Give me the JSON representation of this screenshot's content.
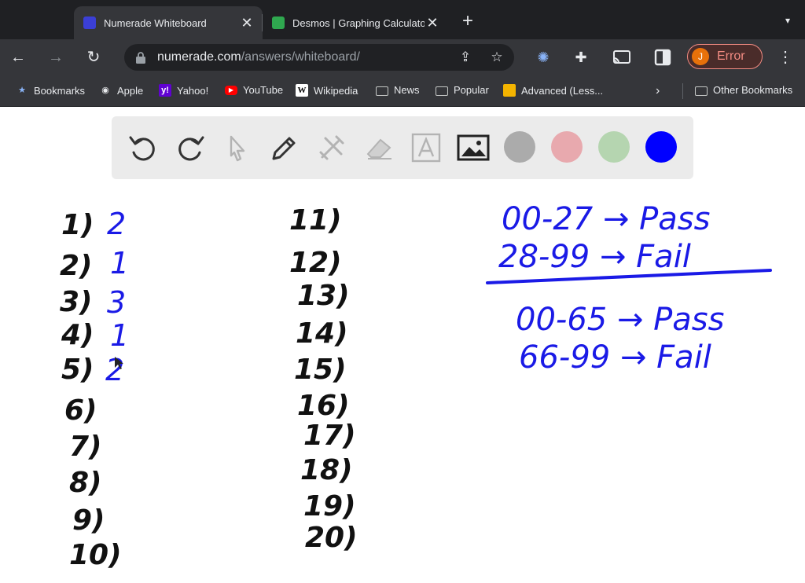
{
  "browser": {
    "tabs": [
      {
        "title": "Numerade Whiteboard",
        "active": true,
        "favicon": "numerade-icon"
      },
      {
        "title": "Desmos | Graphing Calculator",
        "active": false,
        "favicon": "desmos-icon"
      }
    ],
    "address": {
      "host": "numerade.com",
      "path": "/answers/whiteboard/"
    },
    "profile": {
      "initial": "J",
      "status": "Error"
    },
    "bookmarks": [
      {
        "label": "Bookmarks",
        "icon": "star-icon"
      },
      {
        "label": "Apple",
        "icon": "apple-icon"
      },
      {
        "label": "Yahoo!",
        "icon": "yahoo-icon"
      },
      {
        "label": "YouTube",
        "icon": "youtube-icon"
      },
      {
        "label": "Wikipedia",
        "icon": "wikipedia-icon"
      },
      {
        "label": "News",
        "icon": "folder-icon"
      },
      {
        "label": "Popular",
        "icon": "folder-icon"
      },
      {
        "label": "Advanced (Less...",
        "icon": "advanced-icon"
      }
    ],
    "other_bookmarks": "Other Bookmarks"
  },
  "whiteboard": {
    "tools": [
      "undo",
      "redo",
      "select",
      "pen",
      "tools",
      "eraser",
      "text",
      "image"
    ],
    "colors": [
      "#ababab",
      "#e8a9ae",
      "#b5d5b0",
      "#0000ff"
    ],
    "selected_color": "#0000ff"
  },
  "handwriting": {
    "left_list": [
      {
        "label": "1)",
        "answer": "2"
      },
      {
        "label": "2)",
        "answer": "1"
      },
      {
        "label": "3)",
        "answer": "3"
      },
      {
        "label": "4)",
        "answer": "1"
      },
      {
        "label": "5)",
        "answer": "2"
      },
      {
        "label": "6)",
        "answer": ""
      },
      {
        "label": "7)",
        "answer": ""
      },
      {
        "label": "8)",
        "answer": ""
      },
      {
        "label": "9)",
        "answer": ""
      },
      {
        "label": "10)",
        "answer": ""
      }
    ],
    "right_list": [
      "11)",
      "12)",
      "13)",
      "14)",
      "15)",
      "16)",
      "17)",
      "18)",
      "19)",
      "20)"
    ],
    "notes_top": [
      "00-27 → Pass",
      "28-99 → Fail"
    ],
    "notes_bottom": [
      "00-65 → Pass",
      "66-99 → Fail"
    ]
  }
}
